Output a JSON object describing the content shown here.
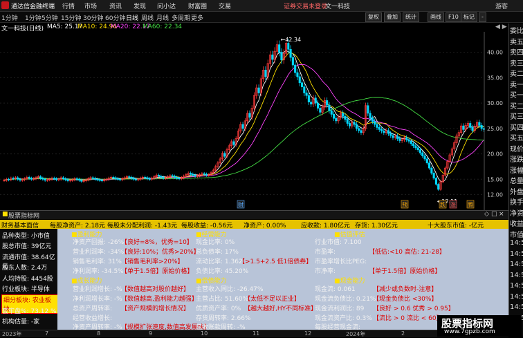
{
  "titlebar": {
    "app": "通达信金融终端",
    "menus": [
      "行情",
      "市场",
      "资讯",
      "发现",
      "问小达",
      "财富圈",
      "交易"
    ],
    "status": "证券交易未登录",
    "user": "文一科技",
    "guest": "游客"
  },
  "toolbar": {
    "timeframes": [
      "1分钟",
      "1分钟",
      "5分钟",
      "15分钟",
      "30分钟",
      "60分钟",
      "日线",
      "周线",
      "月线",
      "多周期",
      "更多"
    ],
    "active_tf": 6,
    "right_buttons": [
      "复权",
      "叠加",
      "统计",
      "画线",
      "F10",
      "标记",
      "-"
    ]
  },
  "ma": {
    "stock": "文一科技(日线)",
    "ma5": "MA5: 25.17",
    "ma10": "MA10: 24.96",
    "ma20": "MA20: 22.17",
    "ma60": "MA60: 22.34"
  },
  "chart_data": {
    "type": "candlestick",
    "y_ticks": [
      12.0,
      15.0,
      20.0,
      25.0,
      30.0,
      35.0,
      40.0
    ],
    "ylim": [
      10,
      43.5
    ],
    "high_label": "42.34",
    "low_label": "12.11",
    "markers": [
      "财",
      "预",
      "跌",
      "涨",
      "腾"
    ],
    "x_labels": [
      "2023年",
      "7",
      "8",
      "9",
      "10",
      "11",
      "12",
      "2024年",
      "2",
      "3"
    ],
    "close": [
      14.8,
      15.0,
      14.9,
      15.2,
      15.1,
      15.3,
      15.0,
      14.8,
      14.9,
      15.1,
      15.4,
      15.2,
      15.0,
      15.1,
      15.3,
      15.5,
      15.2,
      15.0,
      14.8,
      14.9,
      15.0,
      15.2,
      15.1,
      14.9,
      15.0,
      15.3,
      15.1,
      14.9,
      14.7,
      14.8,
      14.9,
      15.1,
      15.0,
      14.8,
      14.6,
      14.7,
      14.9,
      15.1,
      15.3,
      15.2,
      15.0,
      14.9,
      14.8,
      14.7,
      14.9,
      15.0,
      15.2,
      15.4,
      15.3,
      15.1,
      15.0,
      14.9,
      15.1,
      15.3,
      15.5,
      15.4,
      15.2,
      15.0,
      14.9,
      15.0,
      15.2,
      15.4,
      15.3,
      15.1,
      15.0,
      15.2,
      15.5,
      15.8,
      15.6,
      15.4,
      15.2,
      15.3,
      15.5,
      15.7,
      15.6,
      15.4,
      15.2,
      15.1,
      15.3,
      15.6,
      15.9,
      16.2,
      16.0,
      15.8,
      15.6,
      15.7,
      15.9,
      16.1,
      16.0,
      15.8,
      15.9,
      16.3,
      16.8,
      17.5,
      18.2,
      19.0,
      20.1,
      19.5,
      20.8,
      21.6,
      22.4,
      21.8,
      23.0,
      24.5,
      25.8,
      25.0,
      26.5,
      28.0,
      27.2,
      29.0,
      31.5,
      33.0,
      32.0,
      34.8,
      36.5,
      35.2,
      37.8,
      39.5,
      38.6,
      40.2,
      41.5,
      40.0,
      38.5,
      39.8,
      41.8,
      40.6,
      39.0,
      37.5,
      36.0,
      35.2,
      34.0,
      33.2,
      32.0,
      31.5,
      30.2,
      29.8,
      31.0,
      30.0,
      29.0,
      28.2,
      29.2,
      30.5,
      29.6,
      28.5,
      27.8,
      27.0,
      26.5,
      27.2,
      28.0,
      27.4,
      26.8,
      26.0,
      25.5,
      26.2,
      25.8,
      25.0,
      24.6,
      24.2,
      25.0,
      29.5,
      28.0,
      27.0,
      26.4,
      25.8,
      25.2,
      24.8,
      24.5,
      24.2,
      24.6,
      24.0,
      23.6,
      23.2,
      23.5,
      23.0,
      22.6,
      22.8,
      23.2,
      22.8,
      22.5,
      22.0,
      21.6,
      21.2,
      20.8,
      20.2,
      19.6,
      19.0,
      18.2,
      17.2,
      16.2,
      15.2,
      14.0,
      13.0,
      14.5,
      15.8,
      17.2,
      18.5,
      19.8,
      21.0,
      22.2,
      23.5,
      24.2,
      25.5,
      24.8,
      25.6,
      26.0,
      25.2,
      24.6,
      25.4,
      26.2,
      25.6,
      25.0,
      24.8
    ]
  },
  "panel_header": {
    "title": "股票指标网",
    "actions": [
      "◇",
      "□",
      "×"
    ]
  },
  "ybar": {
    "items": [
      "财务基本面信",
      "每股净资产: 2.18元",
      "每股未分配利润: -1.43元",
      "每股收益: -0.56元",
      "净资产: 0.00%",
      "应收款: 1.80亿元",
      "存货: 1.30亿元",
      "十大股东市值: -亿元"
    ]
  },
  "left_panel": {
    "rows": [
      "品种类型: 小市值",
      "股总市值: 39亿元",
      "流通市值: 38.64亿元",
      "股东人数: 2.4万",
      "人均持股: 4454股",
      "行业板块: 半导体",
      "细分板块: 农业板块",
      "套牢盘%: 73.12 %",
      "机构估量: -家"
    ]
  },
  "panels": {
    "profit_title": "■盈利能力",
    "profit_rows": [
      "净资产回报: -26%",
      "营业利润率: -34%",
      "销售毛利率: 31%",
      "净利润率: -34.5%"
    ],
    "profit_notes": [
      "【良好=8%，优秀=10】",
      "【良好:10%；优秀>20%】",
      "【销售毛利率>20%】",
      "【单于1.5倍】原始价格】"
    ],
    "op_title": "■经营能力",
    "op_rows": [
      "现金比率: 0%",
      "总负债率: 17%",
      "流动比率: 1.362",
      "负债比率: 45.20%"
    ],
    "op_notes": [
      "",
      "",
      "【>1.5+2.5 低1倍债券】",
      ""
    ],
    "val_title": "■估值评估",
    "val_rows": [
      "行业市值: 7.100",
      "市盈率: ",
      "市盈率增长比PEG: ",
      "市净率: "
    ],
    "val_notes": [
      "",
      "【低估:<10 高估: 21-28】",
      "",
      "【单于1.5倍】原始价格】"
    ],
    "growth_title": "■成长能力",
    "growth_rows": [
      "营业利润增长: -%",
      "净利润增长率: -%",
      "总资产周转率: ",
      "经营收益增长: ",
      "净资产周转率: -%"
    ],
    "growth_notes": [
      "【数值越高对股价越好】",
      "【数值越高,盈利能力越强】",
      "【资产规模的增长情况】",
      "",
      "【规模扩张速度,数值高发展快】"
    ],
    "debt_title": "■偿债能力",
    "debt_rows": [
      "主营收入同比: -26.47%",
      "主营占比: 51.60%",
      "优质资产率: 0%",
      "存货周转率: 2.66%",
      "应收账款周转: -%"
    ],
    "debt_notes": [
      "",
      "【太低不足以正业】",
      "【越大越好,HY不同标准】",
      "",
      ""
    ],
    "cash_title": "■现金能力",
    "cash_rows": [
      "现金流: 0.061",
      "现金流负债比: 0.21%",
      "现金流利润比: 89",
      "现金流资产比: 0.3%",
      "每股经营现金流: "
    ],
    "cash_notes": [
      "【减少或负数时-注意】",
      "【现金负债比 <30%】",
      "【良好 > 0.6 优秀 > 0.95】",
      "【流比 > 0 流比 < 60】",
      ""
    ]
  },
  "bottom": {
    "labels": [
      "2023年",
      "7",
      "8",
      "9",
      "10",
      "11",
      "12",
      "2024年",
      "2",
      "3"
    ]
  },
  "right_side": {
    "labels": [
      "委比",
      "卖五",
      "卖四",
      "卖三",
      "卖二",
      "卖一",
      "买一",
      "买二",
      "买三",
      "买四",
      "买五",
      "现价",
      "涨跌",
      "涨幅",
      "总量",
      "外盘",
      "换手",
      "净资",
      "收益",
      "市值",
      "14:5",
      "14:5",
      "14:5",
      "14:5",
      "14:5",
      "14:5",
      "14:5",
      "14:5"
    ]
  },
  "watermark": {
    "title": "股票指标网",
    "url": "www.7gpzb.com"
  },
  "colors": {
    "up": "#ff3b3b",
    "down": "#00d8ff",
    "ma5": "#ffffff",
    "ma10": "#ffe000",
    "ma20": "#ff44ff",
    "ma60": "#44dd44",
    "ybar": "#e6c200",
    "panel_bg": "#b8c4d8"
  }
}
